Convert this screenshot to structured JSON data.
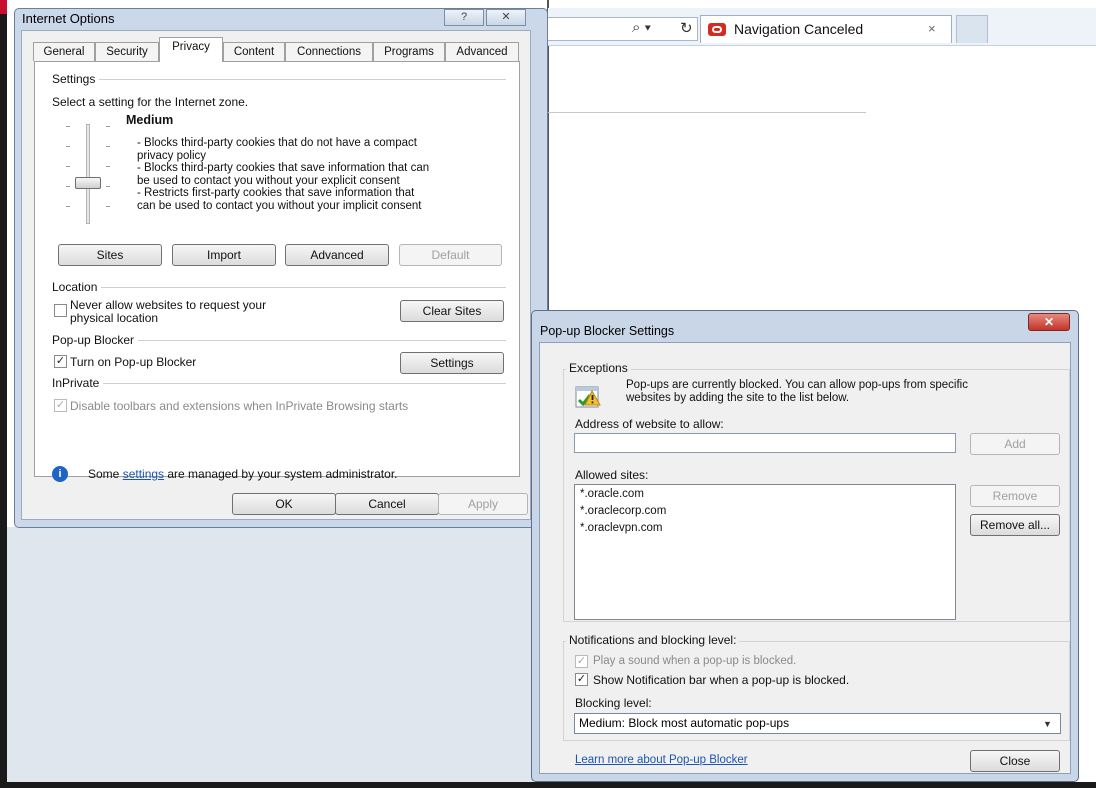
{
  "browser": {
    "tab_label": "Navigation Canceled",
    "tab_close": "×",
    "search_glyph": "⌕ ▾",
    "refresh_glyph": "↻"
  },
  "internet_options": {
    "title": "Internet Options",
    "title_buttons": [
      "?",
      "✕"
    ],
    "tabs": [
      "General",
      "Security",
      "Privacy",
      "Content",
      "Connections",
      "Programs",
      "Advanced"
    ],
    "active_tab": "Privacy",
    "settings": {
      "heading": "Settings",
      "zone_text": "Select a setting for the Internet zone.",
      "level": "Medium",
      "description": "- Blocks third-party cookies that do not have a compact\nprivacy policy\n- Blocks third-party cookies that save information that can\nbe used to contact you without your explicit consent\n- Restricts first-party cookies that save information that\ncan be used to contact you without your implicit consent",
      "buttons": {
        "sites": "Sites",
        "import": "Import",
        "advanced": "Advanced",
        "default": "Default"
      }
    },
    "location": {
      "heading": "Location",
      "never_allow_line1": "Never allow websites to request your",
      "never_allow_line2": "physical location",
      "never_allow_checked": false,
      "clear_sites": "Clear Sites"
    },
    "popup_blocker": {
      "heading": "Pop-up Blocker",
      "turn_on": "Turn on Pop-up Blocker",
      "turn_on_checked": true,
      "settings_button": "Settings"
    },
    "inprivate": {
      "heading": "InPrivate",
      "disable_toolbars": "Disable toolbars and extensions when InPrivate Browsing starts",
      "disable_checked": true
    },
    "info": {
      "prefix": "Some ",
      "link": "settings",
      "suffix": " are managed by your system administrator."
    },
    "footer": {
      "ok": "OK",
      "cancel": "Cancel",
      "apply": "Apply"
    }
  },
  "popup_settings": {
    "title": "Pop-up Blocker Settings",
    "close_glyph": "✕",
    "exceptions": {
      "heading": "Exceptions",
      "message_line1": "Pop-ups are currently blocked.  You can allow pop-ups from specific",
      "message_line2": "websites by adding the site to the list below.",
      "address_label": "Address of website to allow:",
      "address_value": "",
      "add": "Add",
      "allowed_label": "Allowed sites:",
      "allowed_sites": [
        "*.oracle.com",
        "*.oraclecorp.com",
        "*.oraclevpn.com"
      ],
      "remove": "Remove",
      "remove_all": "Remove all..."
    },
    "notifications": {
      "heading": "Notifications and blocking level:",
      "play_sound": "Play a sound when a pop-up is blocked.",
      "play_sound_checked": true,
      "show_bar": "Show Notification bar when a pop-up is blocked.",
      "show_bar_checked": true,
      "blocking_label": "Blocking level:",
      "blocking_value": "Medium: Block most automatic pop-ups"
    },
    "learn_more": "Learn more about Pop-up Blocker",
    "close": "Close"
  }
}
